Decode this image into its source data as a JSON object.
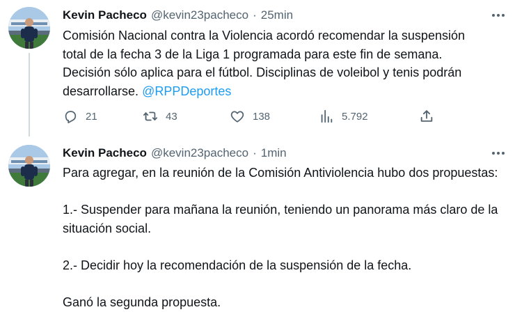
{
  "tweets": [
    {
      "author": {
        "display_name": "Kevin Pacheco",
        "handle": "@kevin23pacheco",
        "avatar_icon": "profile-photo"
      },
      "time": "25min",
      "text_lines": [
        "Comisión Nacional contra la Violencia acordó recomendar la suspensión",
        "total de la fecha 3 de la Liga 1 programada para este fin de semana.",
        "Decisión sólo aplica para el fútbol. Disciplinas de voleibol y tenis podrán"
      ],
      "text_last_line": "desarrollarse.",
      "mention": "@RPPDeportes",
      "stats": {
        "replies": "21",
        "retweets": "43",
        "likes": "138",
        "views": "5.792"
      }
    },
    {
      "author": {
        "display_name": "Kevin Pacheco",
        "handle": "@kevin23pacheco",
        "avatar_icon": "profile-photo"
      },
      "time": "1min",
      "paragraphs": [
        "Para agregar, en la reunión de la Comisión Antiviolencia hubo dos propuestas:",
        "1.- Suspender para mañana la reunión, teniendo un panorama más claro de la situación social.",
        "2.- Decidir hoy la recomendación de la suspensión de la fecha.",
        "Ganó la segunda propuesta."
      ]
    }
  ],
  "ui": {
    "separator": "·",
    "accent_color": "#1d9bf0",
    "text_color": "#0f1419",
    "muted_color": "#536471"
  }
}
